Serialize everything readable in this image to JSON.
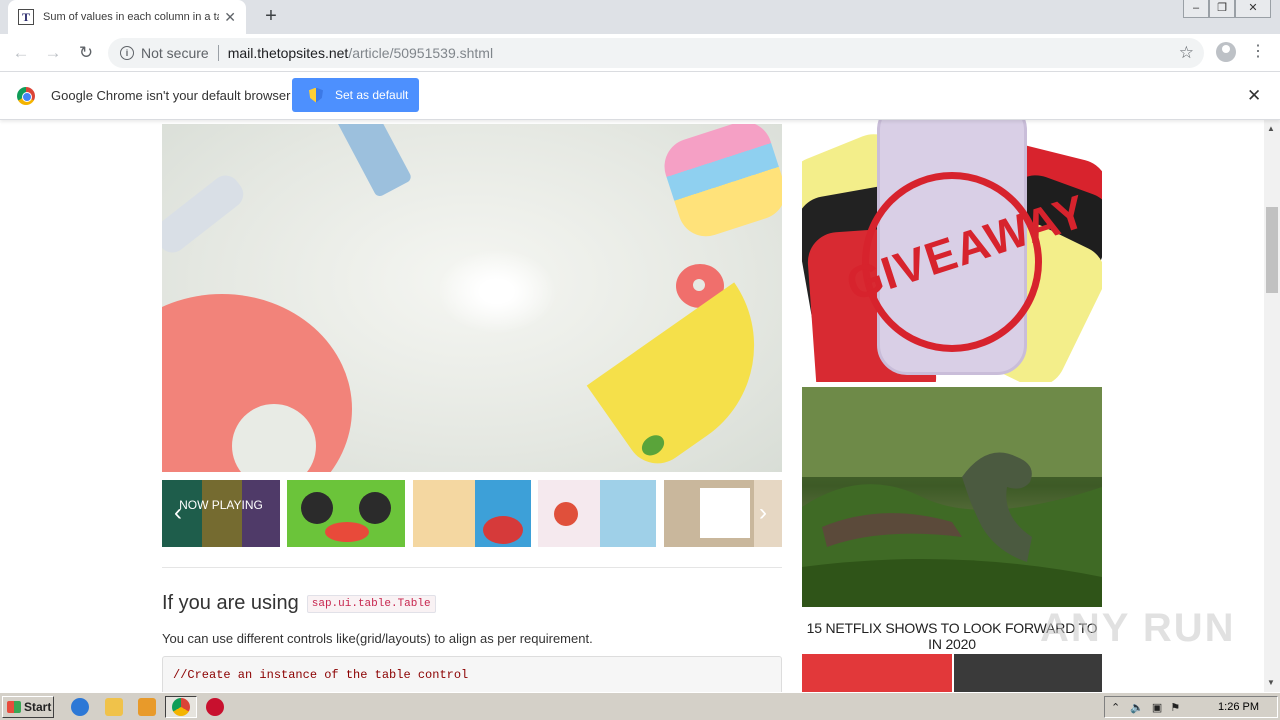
{
  "browser": {
    "tab": {
      "title": "Sum of values in each column in a table",
      "favicon_letter": "T"
    },
    "window_controls": [
      "minimize",
      "restore",
      "close"
    ],
    "address": {
      "security_label": "Not secure",
      "host": "mail.thetopsites.net",
      "path": "/article/50951539.shtml"
    }
  },
  "infobar": {
    "message": "Google Chrome isn't your default browser",
    "button_label": "Set as default"
  },
  "article": {
    "thumbs": [
      {
        "label": "NOW PLAYING",
        "colors": [
          "#2f8f73",
          "#b4a54a",
          "#7a5aa0"
        ]
      },
      {
        "label": "",
        "colors": [
          "#6bc43a",
          "#2b2b2b",
          "#e84a3a"
        ]
      },
      {
        "label": "",
        "colors": [
          "#f4d7a1",
          "#3da0d8",
          "#d63a3a"
        ]
      },
      {
        "label": "",
        "colors": [
          "#f5e9ee",
          "#e0503b",
          "#9fd0e8"
        ]
      },
      {
        "label": "",
        "colors": [
          "#c9b79c",
          "#ffffff",
          "#e6d7c3"
        ]
      }
    ],
    "heading_text": "If you are using",
    "heading_code": "sap.ui.table.Table",
    "paragraph": "You can use different controls like(grid/layouts) to align as per requirement.",
    "code_line": "//Create an instance of the table control"
  },
  "sidebar": {
    "giveaway_text": "GIVEAWAY",
    "caption": "15 NETFLIX SHOWS TO LOOK FORWARD TO IN 2020"
  },
  "watermark": "ANY RUN",
  "taskbar": {
    "start_label": "Start",
    "clock": "1:26 PM"
  },
  "colors": {
    "accent_button": "#4d90fe",
    "code_red": "#c7254e",
    "stamp_red": "#d7232d"
  }
}
